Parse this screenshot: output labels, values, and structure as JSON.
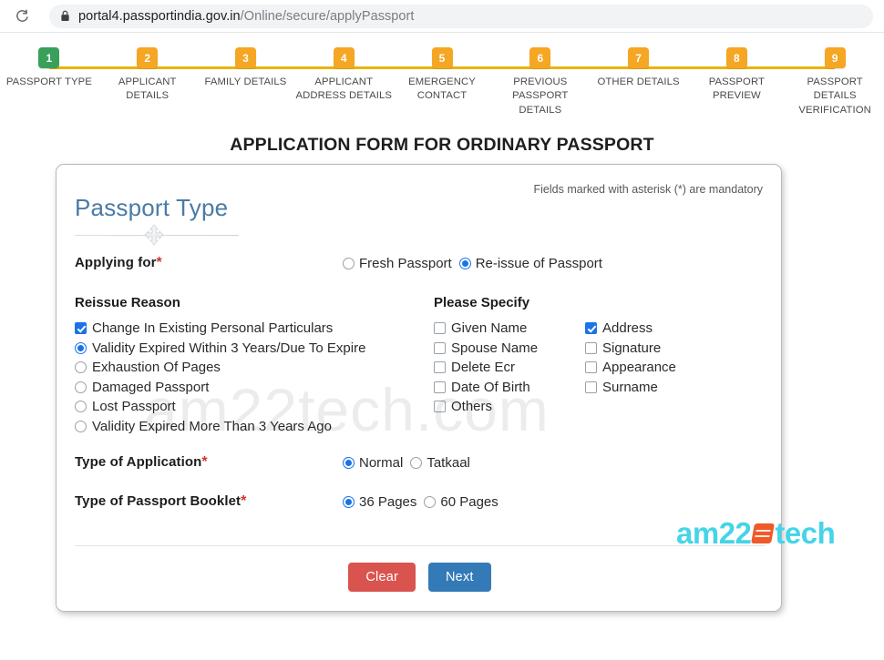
{
  "browser": {
    "reload_icon": "reload-icon",
    "lock_icon": "lock-icon",
    "url_host": "portal4.passportindia.gov.in",
    "url_path": "/Online/secure/applyPassport"
  },
  "stepper": {
    "current_step": 1,
    "current_color": "#39a05a",
    "step_color": "#f5a623",
    "track_color": "#eab308",
    "steps": [
      {
        "number": "1",
        "label": "PASSPORT TYPE"
      },
      {
        "number": "2",
        "label": "APPLICANT\nDETAILS"
      },
      {
        "number": "3",
        "label": "FAMILY DETAILS"
      },
      {
        "number": "4",
        "label": "APPLICANT\nADDRESS DETAILS"
      },
      {
        "number": "5",
        "label": "EMERGENCY\nCONTACT"
      },
      {
        "number": "6",
        "label": "PREVIOUS\nPASSPORT DETAILS"
      },
      {
        "number": "7",
        "label": "OTHER DETAILS"
      },
      {
        "number": "8",
        "label": "PASSPORT\nPREVIEW"
      },
      {
        "number": "9",
        "label": "PASSPORT DETAILS\nVERIFICATION"
      }
    ]
  },
  "page": {
    "title": "APPLICATION FORM FOR ORDINARY PASSPORT",
    "watermark": "am22tech.com"
  },
  "form": {
    "mandatory_note": "Fields marked with asterisk (*) are mandatory",
    "section_title": "Passport Type",
    "applying_for": {
      "label": "Applying for",
      "required": "*",
      "options": [
        {
          "label": "Fresh Passport",
          "selected": false
        },
        {
          "label": "Re-issue of Passport",
          "selected": true
        }
      ]
    },
    "reissue_reason": {
      "title": "Reissue Reason",
      "items": [
        {
          "label": "Change In Existing Personal Particulars",
          "control": "checkbox",
          "checked": true
        },
        {
          "label": "Validity Expired Within 3 Years/Due To Expire",
          "control": "radio",
          "checked": true
        },
        {
          "label": "Exhaustion Of Pages",
          "control": "radio",
          "checked": false
        },
        {
          "label": "Damaged Passport",
          "control": "radio",
          "checked": false
        },
        {
          "label": "Lost Passport",
          "control": "radio",
          "checked": false
        },
        {
          "label": "Validity Expired More Than 3 Years Ago",
          "control": "radio",
          "checked": false
        }
      ]
    },
    "please_specify": {
      "title": "Please Specify",
      "column_one": [
        {
          "label": "Given Name",
          "checked": false
        },
        {
          "label": "Spouse Name",
          "checked": false
        },
        {
          "label": "Delete Ecr",
          "checked": false
        },
        {
          "label": "Date Of Birth",
          "checked": false
        },
        {
          "label": "Others",
          "checked": false
        }
      ],
      "column_two": [
        {
          "label": "Address",
          "checked": true
        },
        {
          "label": "Signature",
          "checked": false
        },
        {
          "label": "Appearance",
          "checked": false
        },
        {
          "label": "Surname",
          "checked": false
        }
      ]
    },
    "type_of_application": {
      "label": "Type of Application",
      "required": "*",
      "options": [
        {
          "label": "Normal",
          "selected": true
        },
        {
          "label": "Tatkaal",
          "selected": false
        }
      ]
    },
    "type_of_booklet": {
      "label": "Type of Passport Booklet",
      "required": "*",
      "options": [
        {
          "label": "36 Pages",
          "selected": true
        },
        {
          "label": "60 Pages",
          "selected": false
        }
      ]
    },
    "buttons": {
      "clear": "Clear",
      "clear_color": "#d9534f",
      "next": "Next",
      "next_color": "#337ab7"
    }
  },
  "logo": {
    "text_left": "am22",
    "text_right": "tech",
    "color": "#45d4e8",
    "mark_color": "#f05a28"
  }
}
